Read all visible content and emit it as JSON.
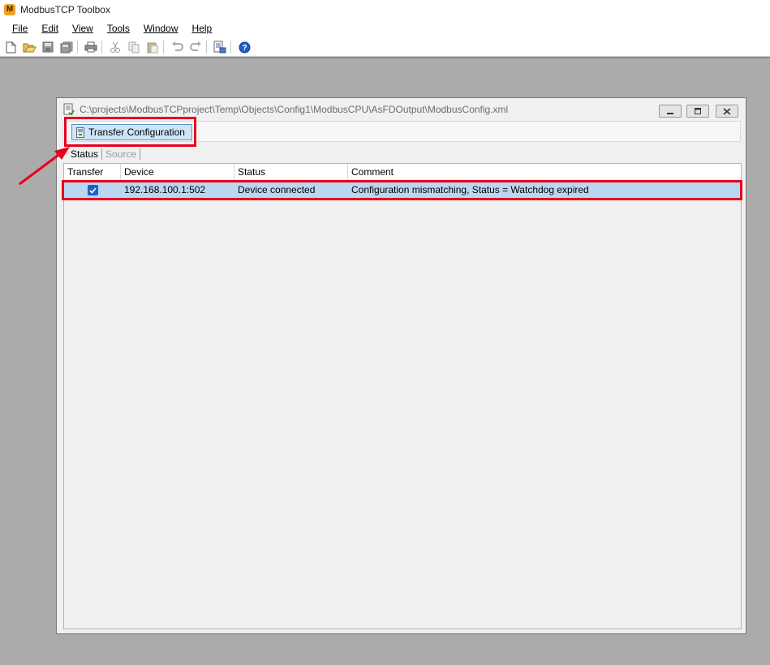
{
  "app": {
    "title": "ModbusTCP Toolbox",
    "icon_letter": "M"
  },
  "menu": [
    {
      "label": "File"
    },
    {
      "label": "Edit"
    },
    {
      "label": "View"
    },
    {
      "label": "Tools"
    },
    {
      "label": "Window"
    },
    {
      "label": "Help"
    }
  ],
  "toolbar": {
    "icons": [
      "new-icon",
      "open-icon",
      "save-icon",
      "save-all-icon",
      "print-icon",
      "cut-icon",
      "copy-icon",
      "paste-icon",
      "undo-icon",
      "redo-icon",
      "properties-icon",
      "help-icon"
    ]
  },
  "child": {
    "title": "C:\\projects\\ModbusTCPproject\\Temp\\Objects\\Config1\\ModbusCPU\\AsFDOutput\\ModbusConfig.xml",
    "transfer_button_label": "Transfer Configuration",
    "tabs": [
      {
        "label": "Status",
        "active": true
      },
      {
        "label": "Source",
        "active": false
      }
    ],
    "grid": {
      "columns": [
        "Transfer",
        "Device",
        "Status",
        "Comment"
      ],
      "rows": [
        {
          "transfer_checked": true,
          "device": "192.168.100.1:502",
          "status": "Device connected",
          "comment": "Configuration mismatching, Status = Watchdog expired"
        }
      ]
    }
  },
  "colors": {
    "highlight": "#e8001c",
    "selected_row": "#b9d7f1",
    "workspace": "#ababab",
    "checkbox": "#1a63c9"
  }
}
